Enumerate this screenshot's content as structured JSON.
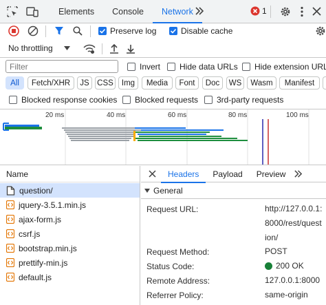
{
  "top_tabs": [
    "Elements",
    "Console",
    "Network"
  ],
  "error_count": "1",
  "toolbar1": {
    "preserve_log": "Preserve log",
    "disable_cache": "Disable cache"
  },
  "toolbar2": {
    "throttling": "No throttling"
  },
  "filter": {
    "placeholder": "Filter",
    "invert": "Invert",
    "hide_data_urls": "Hide data URLs",
    "hide_extension_urls": "Hide extension URL"
  },
  "type_chips": [
    "All",
    "Fetch/XHR",
    "JS",
    "CSS",
    "Img",
    "Media",
    "Font",
    "Doc",
    "WS",
    "Wasm",
    "Manifest"
  ],
  "blocked": {
    "blocked_cookies": "Blocked response cookies",
    "blocked_requests": "Blocked requests",
    "third_party": "3rd-party requests"
  },
  "timeline_labels": [
    "20 ms",
    "40 ms",
    "60 ms",
    "80 ms",
    "100 ms"
  ],
  "request_list": {
    "header": "Name",
    "items": [
      "question/",
      "jquery-3.5.1.min.js",
      "ajax-form.js",
      "csrf.js",
      "bootstrap.min.js",
      "prettify-min.js",
      "default.js"
    ]
  },
  "details": {
    "tabs": [
      "Headers",
      "Payload",
      "Preview"
    ],
    "section": "General",
    "request_url_key": "Request URL:",
    "request_url_lines": [
      "http://127.0.0.1:",
      "8000/rest/quest",
      "ion/"
    ],
    "request_method_key": "Request Method:",
    "request_method": "POST",
    "status_code_key": "Status Code:",
    "status_code": "200 OK",
    "remote_address_key": "Remote Address:",
    "remote_address": "127.0.0.1:8000",
    "referrer_policy_key": "Referrer Policy:",
    "referrer_policy": "same-origin"
  },
  "colors": {
    "accent": "#1a73e8",
    "status_ok": "#188038",
    "error": "#dc362e"
  }
}
